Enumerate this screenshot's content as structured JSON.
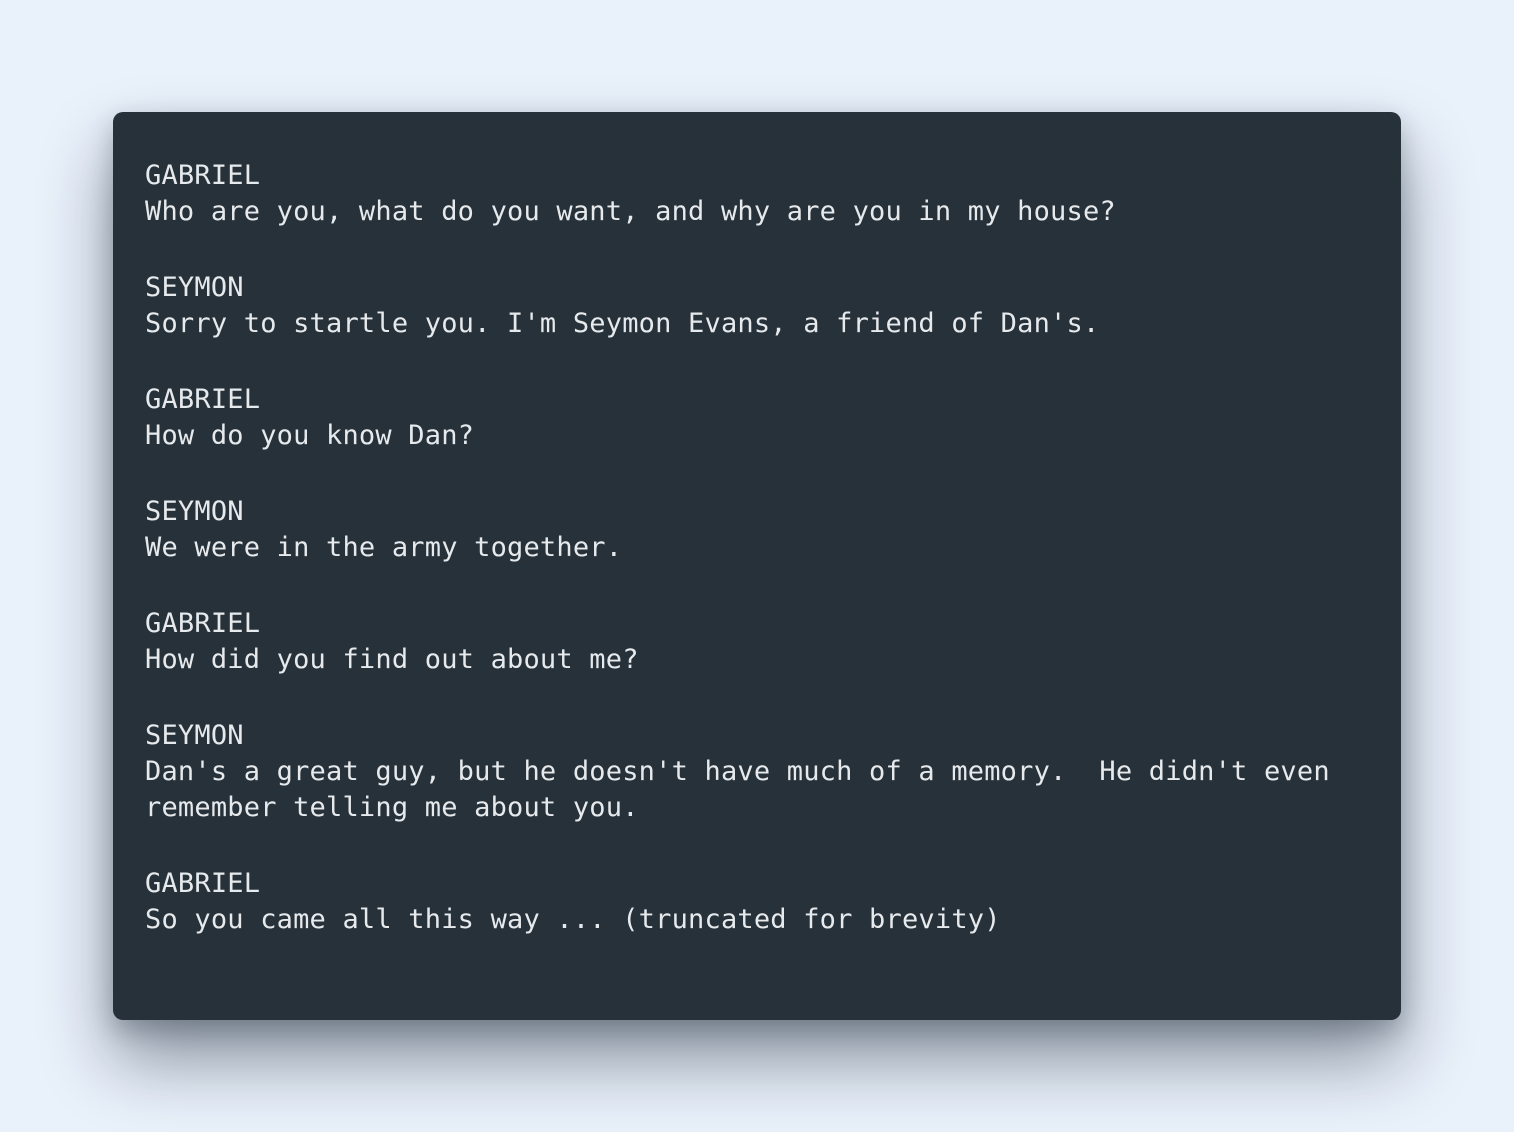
{
  "dialogue": [
    {
      "speaker": "GABRIEL",
      "lines": [
        "Who are you, what do you want, and why are you in my house?"
      ]
    },
    {
      "speaker": "SEYMON",
      "lines": [
        "Sorry to startle you. I'm Seymon Evans, a friend of Dan's."
      ]
    },
    {
      "speaker": "GABRIEL",
      "lines": [
        "How do you know Dan?"
      ]
    },
    {
      "speaker": "SEYMON",
      "lines": [
        "We were in the army together."
      ]
    },
    {
      "speaker": "GABRIEL",
      "lines": [
        "How did you find out about me?"
      ]
    },
    {
      "speaker": "SEYMON",
      "lines": [
        "Dan's a great guy, but he doesn't have much of a memory.  He didn't even",
        "remember telling me about you."
      ]
    },
    {
      "speaker": "GABRIEL",
      "lines": [
        "So you came all this way ... (truncated for brevity)"
      ]
    }
  ]
}
